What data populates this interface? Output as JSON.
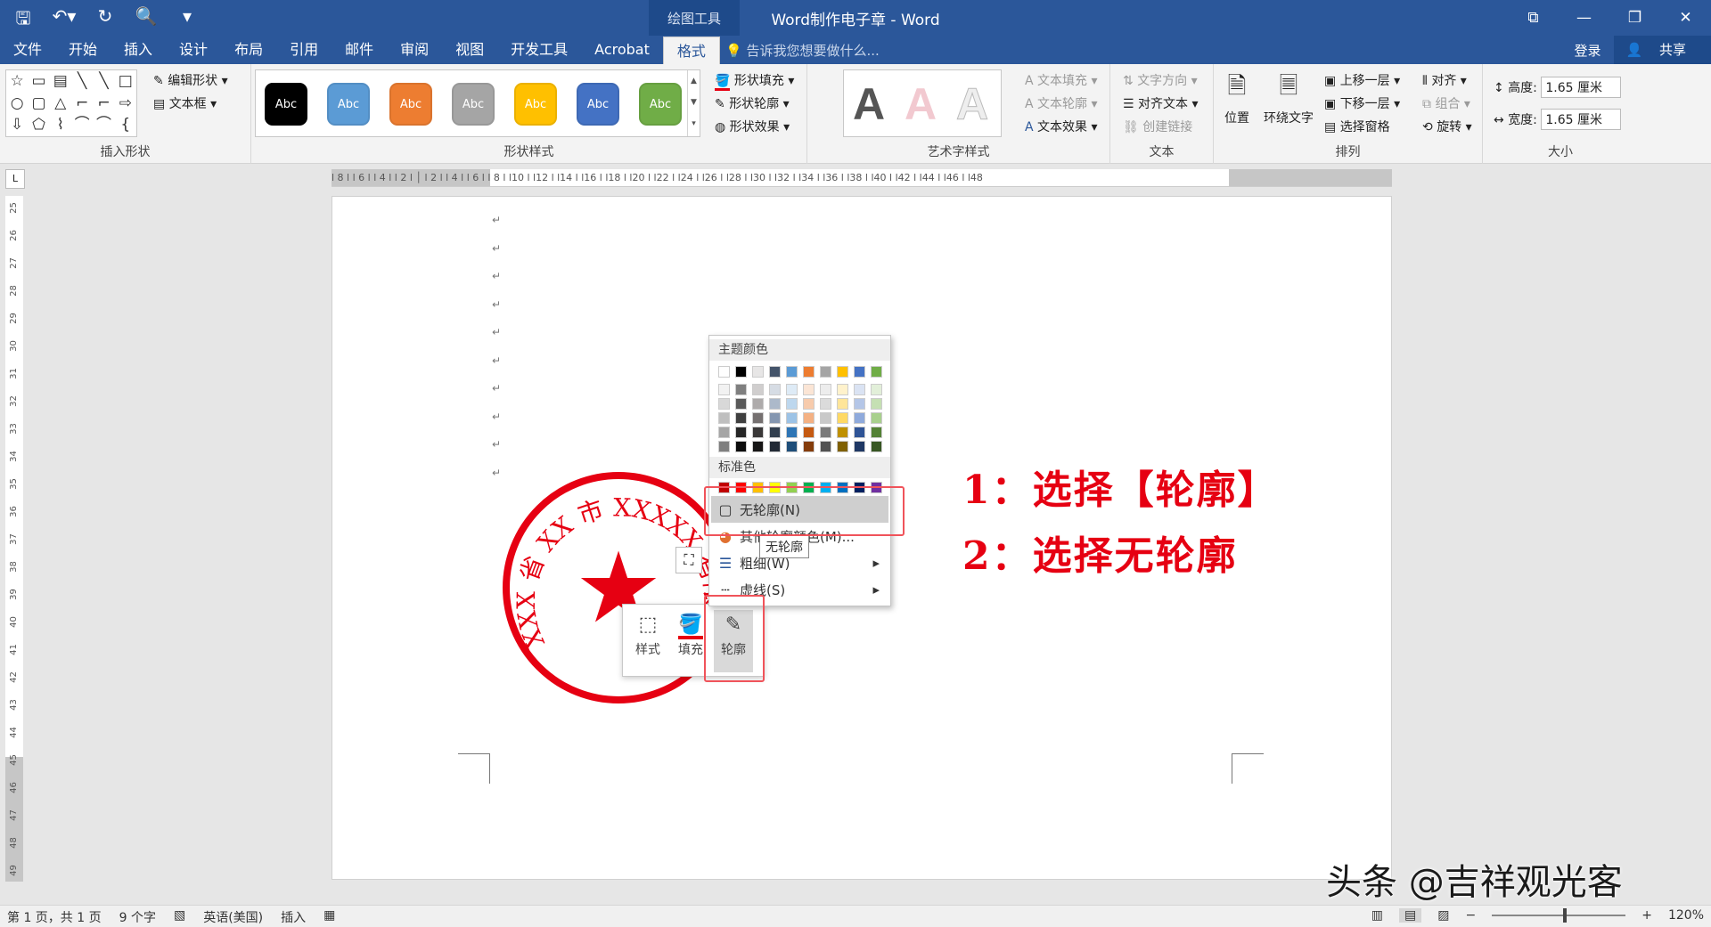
{
  "titlebar": {
    "title": "Word制作电子章 - Word",
    "context_group": "绘图工具",
    "qat": {
      "save": "🖫",
      "undo": "↶▾",
      "redo": "↻",
      "preview": "🔍",
      "more": "▾"
    },
    "window": {
      "ribbon_opts": "⧉",
      "minimize": "—",
      "restore": "❐",
      "close": "✕"
    }
  },
  "tabs": [
    "文件",
    "开始",
    "插入",
    "设计",
    "布局",
    "引用",
    "邮件",
    "审阅",
    "视图",
    "开发工具",
    "Acrobat",
    "格式"
  ],
  "active_tab": "格式",
  "tellme": "告诉我您想要做什么...",
  "account": {
    "login": "登录",
    "share": "共享"
  },
  "ribbon": {
    "insert_shapes": {
      "label": "插入形状",
      "edit_shape": "编辑形状 ▾",
      "text_box": "文本框 ▾",
      "glyphs": [
        "☆",
        "▭",
        "▤",
        "╲",
        "╲",
        "□",
        "○",
        "▢",
        "△",
        "⌐",
        "⌐",
        "⇨",
        "⇩",
        "⬠",
        "⌇",
        "⌒",
        "⌒",
        "{"
      ]
    },
    "shape_styles": {
      "label": "形状样式",
      "swatch_text": "Abc",
      "fill": "形状填充 ▾",
      "outline": "形状轮廓 ▾",
      "effects": "形状效果 ▾",
      "colors": [
        "#000000",
        "#5b9bd5",
        "#ed7d31",
        "#a5a5a5",
        "#ffc000",
        "#4472c4",
        "#70ad47"
      ]
    },
    "wordart": {
      "label": "艺术字样式",
      "letter": "A",
      "text_fill": "文本填充 ▾",
      "text_outline": "文本轮廓 ▾",
      "text_effects": "文本效果 ▾"
    },
    "text": {
      "label": "文本",
      "direction": "文字方向 ▾",
      "align": "对齐文本 ▾",
      "link": "创建链接"
    },
    "arrange": {
      "label": "排列",
      "position": "位置",
      "wrap": "环绕文字",
      "forward": "上移一层 ▾",
      "backward": "下移一层 ▾",
      "pane": "选择窗格",
      "align": "对齐 ▾",
      "group": "组合 ▾",
      "rotate": "旋转 ▾"
    },
    "size": {
      "label": "大小",
      "height_label": "高度:",
      "height_value": "1.65 厘米",
      "width_label": "宽度:",
      "width_value": "1.65 厘米"
    }
  },
  "ruler": {
    "h_ticks": "l 8 l  l 6 l  l 4 l  l 2 l  │  l 2 l  l 4 l  l 6 l  l 8 l  l10 l  l12 l  l14 l  l16 l  l18 l  l20 l  l22 l  l24 l  l26 l  l28 l  l30 l  l32 l  l34 l  l36 l  l38 l  l40 l  l42 l  l44 l  l46 l  l48",
    "v_ticks": [
      "25",
      "26",
      "27",
      "28",
      "29",
      "30",
      "31",
      "32",
      "33",
      "34",
      "35",
      "36",
      "37",
      "38",
      "39",
      "40",
      "41",
      "42",
      "43",
      "44",
      "45",
      "46",
      "47",
      "48",
      "49"
    ],
    "corner": "L"
  },
  "document": {
    "para_mark": "↵",
    "seal_text": "XXX 省 XX 市 XXXXX 有限公司",
    "seal_star": "★",
    "seal_color": "#e60012"
  },
  "annotations": [
    "1：选择【轮廓】",
    "2：选择无轮廓"
  ],
  "mini_toolbar": {
    "style": "样式",
    "fill": "填充",
    "outline": "轮廓"
  },
  "outline_menu": {
    "theme_header": "主题颜色",
    "standard_header": "标准色",
    "no_outline": "无轮廓(N)",
    "more_colors": "其他轮廓颜色(M)...",
    "weight": "粗细(W)",
    "dashes": "虚线(S)",
    "tooltip": "无轮廓",
    "theme_top": [
      "#ffffff",
      "#000000",
      "#e7e6e6",
      "#44546a",
      "#5b9bd5",
      "#ed7d31",
      "#a5a5a5",
      "#ffc000",
      "#4472c4",
      "#70ad47"
    ],
    "theme_shades": [
      [
        "#f2f2f2",
        "#7f7f7f",
        "#d0cece",
        "#d6dce4",
        "#deebf6",
        "#fbe5d5",
        "#ededed",
        "#fff2cc",
        "#dae3f3",
        "#e2efd9"
      ],
      [
        "#d8d8d8",
        "#595959",
        "#aeabab",
        "#acb9ca",
        "#bdd7ee",
        "#f7cbac",
        "#dbdbdb",
        "#ffe599",
        "#b4c6e7",
        "#c5e0b3"
      ],
      [
        "#bfbfbf",
        "#3f3f3f",
        "#757070",
        "#8496b0",
        "#9dc3e6",
        "#f4b183",
        "#c9c9c9",
        "#ffd965",
        "#8faadc",
        "#a8d08d"
      ],
      [
        "#a5a5a5",
        "#262626",
        "#3a3838",
        "#323f4f",
        "#2e75b5",
        "#c55a11",
        "#7b7b7b",
        "#bf9000",
        "#2f5496",
        "#538135"
      ],
      [
        "#7f7f7f",
        "#0c0c0c",
        "#171616",
        "#222a35",
        "#1e4e79",
        "#843c0b",
        "#525252",
        "#7f6000",
        "#1f3864",
        "#375623"
      ]
    ],
    "standard": [
      "#c00000",
      "#ff0000",
      "#ffc000",
      "#ffff00",
      "#92d050",
      "#00b050",
      "#00b0f0",
      "#0070c0",
      "#002060",
      "#7030a0"
    ]
  },
  "statusbar": {
    "page": "第 1 页，共 1 页",
    "words": "9 个字",
    "lang": "英语(美国)",
    "mode": "插入",
    "zoom": "120%"
  },
  "watermark": "头条 @吉祥观光客"
}
